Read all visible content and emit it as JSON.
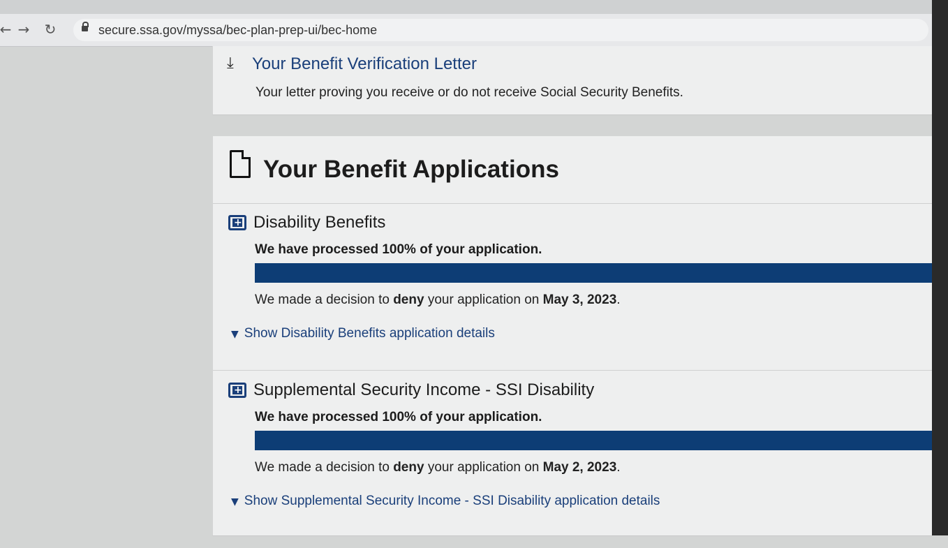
{
  "browser": {
    "url": "secure.ssa.gov/myssa/bec-plan-prep-ui/bec-home",
    "back_icon": "back-arrow-icon",
    "forward_icon": "forward-arrow-icon",
    "reload_icon": "reload-icon"
  },
  "letter": {
    "title": "Your Benefit Verification Letter",
    "description": "Your letter proving you receive or do not receive Social Security Benefits.",
    "icon": "download-icon"
  },
  "applications": {
    "title": "Your Benefit Applications",
    "icon": "document-icon",
    "items": [
      {
        "title": "Disability Benefits",
        "icon": "medical-kit-icon",
        "processed": "We have processed 100% of your application.",
        "progress_percent": 100,
        "decision_prefix": "We made a decision to ",
        "decision_word": "deny",
        "decision_middle": " your application on ",
        "decision_date": "May 3, 2023",
        "decision_suffix": ".",
        "details_link": "Show Disability Benefits application details"
      },
      {
        "title": "Supplemental Security Income - SSI Disability",
        "icon": "medical-kit-icon",
        "processed": "We have processed 100% of your application.",
        "progress_percent": 100,
        "decision_prefix": "We made a decision to ",
        "decision_word": "deny",
        "decision_middle": " your application on ",
        "decision_date": "May 2, 2023",
        "decision_suffix": ".",
        "details_link": "Show Supplemental Security Income - SSI Disability application details"
      }
    ]
  },
  "colors": {
    "link": "#1a3f7a",
    "progress_fill": "#0d3d75",
    "card_bg": "#eeefef"
  }
}
